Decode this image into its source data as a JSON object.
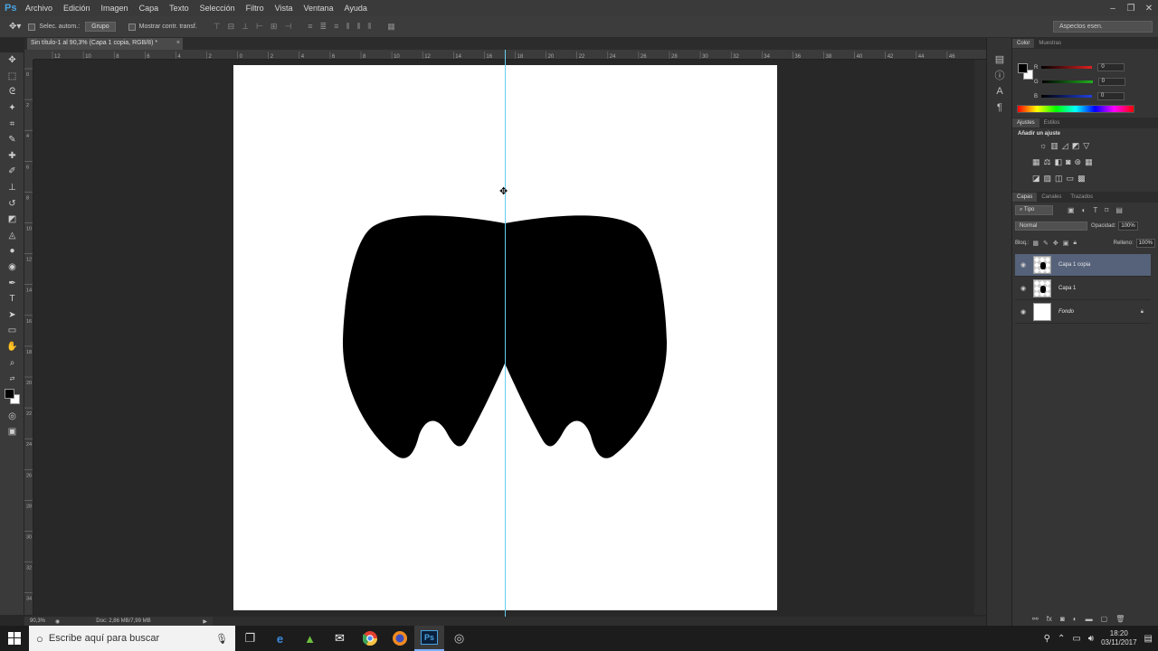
{
  "app": {
    "logo": "Ps"
  },
  "menu": [
    "Archivo",
    "Edición",
    "Imagen",
    "Capa",
    "Texto",
    "Selección",
    "Filtro",
    "Vista",
    "Ventana",
    "Ayuda"
  ],
  "options": {
    "auto_select_label": "Selec. autom.:",
    "auto_select_target": "Grupo",
    "transform_label": "Mostrar contr. transf.",
    "workspace": "Aspectos esen."
  },
  "document": {
    "tab_title": "Sin título-1 al 90,3% (Capa 1 copia, RGB/8) *"
  },
  "ruler_h": [
    "12",
    "10",
    "8",
    "6",
    "4",
    "2",
    "0",
    "2",
    "4",
    "6",
    "8",
    "10",
    "12",
    "14",
    "16",
    "18",
    "20",
    "22",
    "24",
    "26",
    "28",
    "30",
    "32",
    "34",
    "36",
    "38",
    "40",
    "42",
    "44",
    "46"
  ],
  "ruler_v": [
    "0",
    "2",
    "4",
    "6",
    "8",
    "10",
    "12",
    "14",
    "16",
    "18",
    "20",
    "22",
    "24",
    "26",
    "28",
    "30",
    "32",
    "34"
  ],
  "status": {
    "zoom": "90,3%",
    "doc_info": "Doc: 2,86 MB/7,99 MB"
  },
  "color_panel": {
    "tabs": [
      "Color",
      "Muestras"
    ],
    "channels": [
      {
        "label": "R",
        "value": "0",
        "color": "#e02020"
      },
      {
        "label": "G",
        "value": "0",
        "color": "#20b020"
      },
      {
        "label": "B",
        "value": "0",
        "color": "#2040e0"
      }
    ]
  },
  "adjustments_panel": {
    "tabs": [
      "Ajustes",
      "Estilos"
    ],
    "heading": "Añadir un ajuste"
  },
  "layers_panel": {
    "tabs": [
      "Capas",
      "Canales",
      "Trazados"
    ],
    "filter": "Tipo",
    "blend_mode": "Normal",
    "opacity_label": "Opacidad:",
    "opacity": "100%",
    "lock_label": "Bloq.:",
    "fill_label": "Relleno:",
    "fill": "100%",
    "layers": [
      {
        "name": "Capa 1 copia",
        "selected": true
      },
      {
        "name": "Capa 1",
        "selected": false
      },
      {
        "name": "Fondo",
        "selected": false
      }
    ]
  },
  "taskbar": {
    "search_placeholder": "Escribe aquí para buscar",
    "time": "18:20",
    "date": "03/11/2017"
  }
}
